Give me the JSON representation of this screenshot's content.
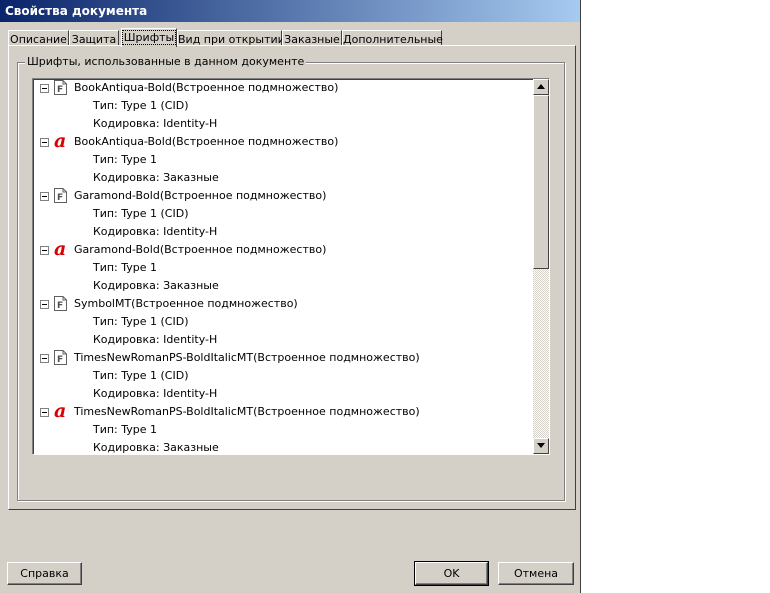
{
  "window": {
    "title": "Свойства документа"
  },
  "tabs": [
    {
      "label": "Описание"
    },
    {
      "label": "Защита"
    },
    {
      "label": "Шрифты"
    },
    {
      "label": "Вид при открытии"
    },
    {
      "label": "Заказные"
    },
    {
      "label": "Дополнительные"
    }
  ],
  "active_tab": "Шрифты",
  "fonts_group": {
    "label": "Шрифты, использованные в данном документе",
    "fonts": [
      {
        "icon": "type1-font-icon",
        "name": "BookAntiqua-Bold(Встроенное подмножество)",
        "type": "Тип: Type 1 (CID)",
        "encoding": "Кодировка: Identity-H"
      },
      {
        "icon": "custom-font-icon",
        "name": "BookAntiqua-Bold(Встроенное подмножество)",
        "type": "Тип: Type 1",
        "encoding": "Кодировка: Заказные"
      },
      {
        "icon": "type1-font-icon",
        "name": "Garamond-Bold(Встроенное подмножество)",
        "type": "Тип: Type 1 (CID)",
        "encoding": "Кодировка: Identity-H"
      },
      {
        "icon": "custom-font-icon",
        "name": "Garamond-Bold(Встроенное подмножество)",
        "type": "Тип: Type 1",
        "encoding": "Кодировка: Заказные"
      },
      {
        "icon": "type1-font-icon",
        "name": "SymbolMT(Встроенное подмножество)",
        "type": "Тип: Type 1 (CID)",
        "encoding": "Кодировка: Identity-H"
      },
      {
        "icon": "type1-font-icon",
        "name": "TimesNewRomanPS-BoldItalicMT(Встроенное подмножество)",
        "type": "Тип: Type 1 (CID)",
        "encoding": "Кодировка: Identity-H"
      },
      {
        "icon": "custom-font-icon",
        "name": "TimesNewRomanPS-BoldItalicMT(Встроенное подмножество)",
        "type": "Тип: Type 1",
        "encoding": "Кодировка: Заказные"
      }
    ],
    "icon_glyphs": {
      "type1": "F",
      "custom": "a"
    }
  },
  "buttons": {
    "help": "Справка",
    "ok": "OK",
    "cancel": "Отмена"
  },
  "colors": {
    "titlebar_start": "#0a246a",
    "titlebar_end": "#a6caf0",
    "custom_font_icon": "#d80000",
    "dialog_bg": "#d4d0c8"
  }
}
